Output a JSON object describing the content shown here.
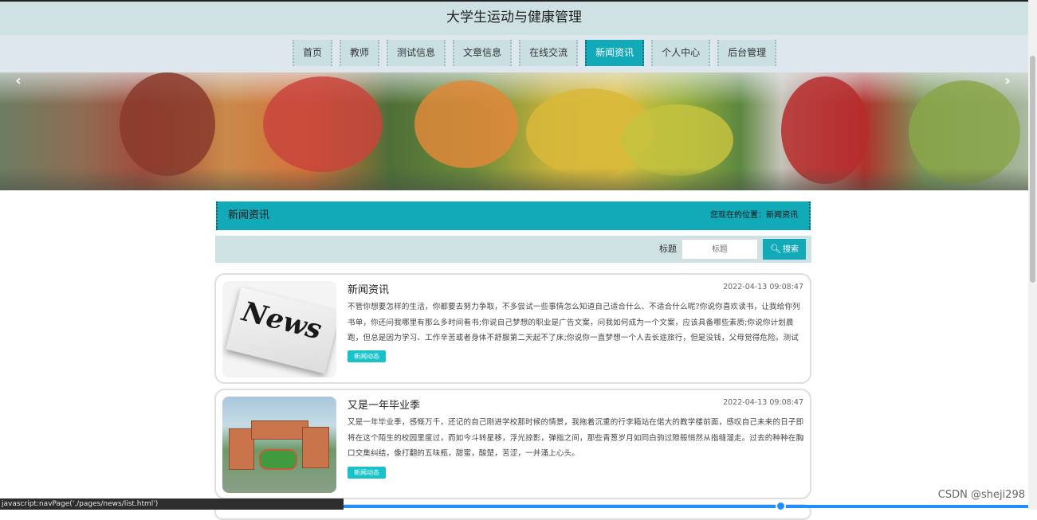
{
  "header": {
    "title": "大学生运动与健康管理"
  },
  "nav": {
    "items": [
      {
        "label": "首页"
      },
      {
        "label": "教师"
      },
      {
        "label": "测试信息"
      },
      {
        "label": "文章信息"
      },
      {
        "label": "在线交流"
      },
      {
        "label": "新闻资讯"
      },
      {
        "label": "个人中心"
      },
      {
        "label": "后台管理"
      }
    ],
    "active_index": 5
  },
  "banner": {
    "prev_icon": "‹",
    "next_icon": "›"
  },
  "section": {
    "title": "新闻资讯",
    "location": "您现在的位置：新闻资讯"
  },
  "search": {
    "label": "标题",
    "placeholder": "标题",
    "button": "搜索"
  },
  "news": [
    {
      "title": "新闻资讯",
      "date": "2022-04-13 09:08:47",
      "desc": "不管你想要怎样的生活，你都要去努力争取，不多尝试一些事情怎么知道自己适合什么、不适合什么呢?你说你喜欢读书，让我给你列书单，你还问我哪里有那么多时间看书;你说自己梦想的职业是广告文案，问我如何成为一个文案，应该具备哪些素质;你说你计划晨跑，但总是因为学习、工作辛苦或者身体不舒服第二天起不了床;你说你一直梦想一个人去长途旅行，但是没钱，父母觉得危险。测试",
      "tag": "新闻动态",
      "image": "newspaper"
    },
    {
      "title": "又是一年毕业季",
      "date": "2022-04-13 09:08:47",
      "desc": "又是一年毕业季，感慨万千，还记的自己刚进学校那时候的情景，我拖着沉重的行李箱站在偌大的教学楼前面，感叹自己未来的日子即将在这个陌生的校园里度过，而如今斗转星移，浮光掠影，弹指之间，那些青葱岁月如同白驹过隙般悄然从指缝溜走。过去的种种在胸口交集纠结，像打翻的五味瓶，甜蜜，酸楚，苦涩，一并涌上心头。",
      "tag": "新闻动态",
      "image": "campus"
    }
  ],
  "statusbar": {
    "text": "javascript:navPage('./pages/news/list.html')"
  },
  "watermark": "CSDN @sheji298",
  "colors": {
    "accent": "#12aab8",
    "header_bg": "#cfe2e3",
    "tag": "#17c3c9"
  }
}
